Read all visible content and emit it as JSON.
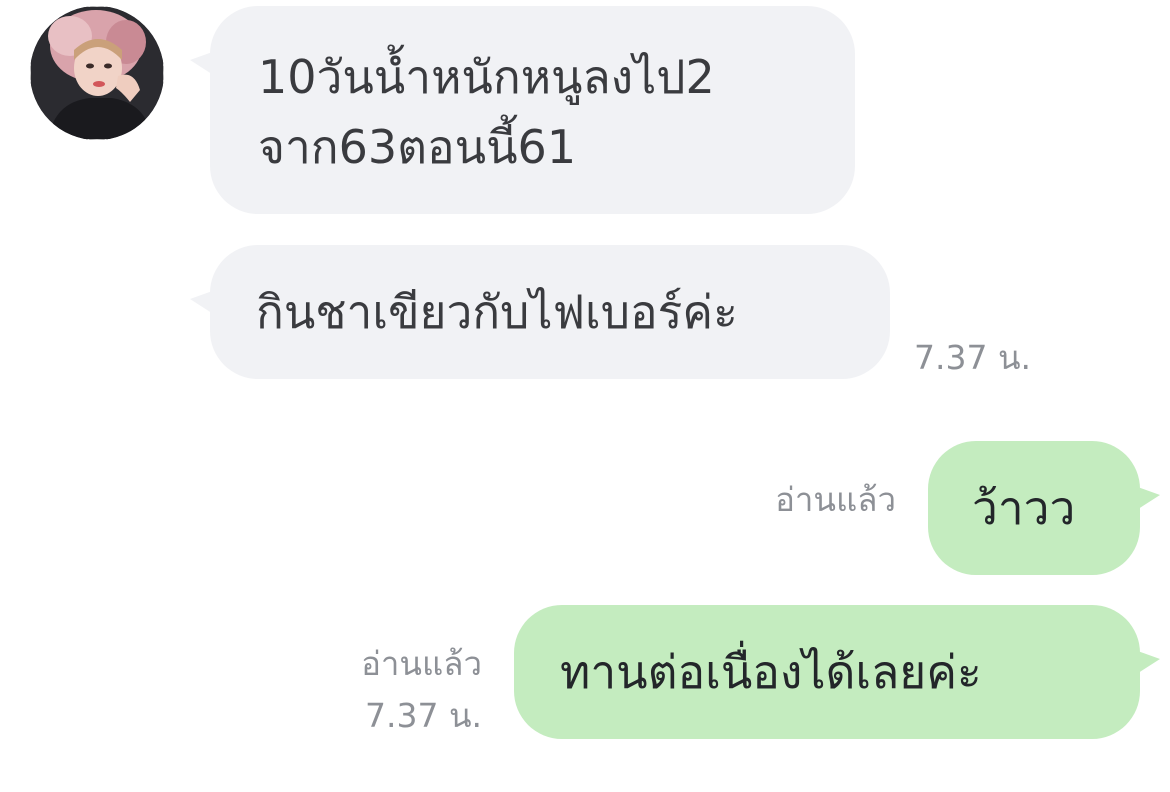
{
  "contact": {
    "avatar_icon": "profile-photo"
  },
  "messages": [
    {
      "direction": "incoming",
      "lines": [
        "10วันน้ำหนักหนูลงไป2",
        "จาก63ตอนนี้61"
      ]
    },
    {
      "direction": "incoming",
      "lines": [
        "กินชาเขียวกับไฟเบอร์ค่ะ"
      ],
      "time": "7.37 น."
    },
    {
      "direction": "outgoing",
      "lines": [
        "ว้าวว"
      ],
      "read_status": "อ่านแล้ว"
    },
    {
      "direction": "outgoing",
      "lines": [
        "ทานต่อเนื่องได้เลยค่ะ"
      ],
      "read_status": "อ่านแล้ว",
      "time": "7.37 น."
    }
  ],
  "colors": {
    "incoming_bubble": "#f1f2f5",
    "outgoing_bubble": "#c4ecbf",
    "meta_text": "#8d9096",
    "message_text": "#3a3b3f"
  }
}
